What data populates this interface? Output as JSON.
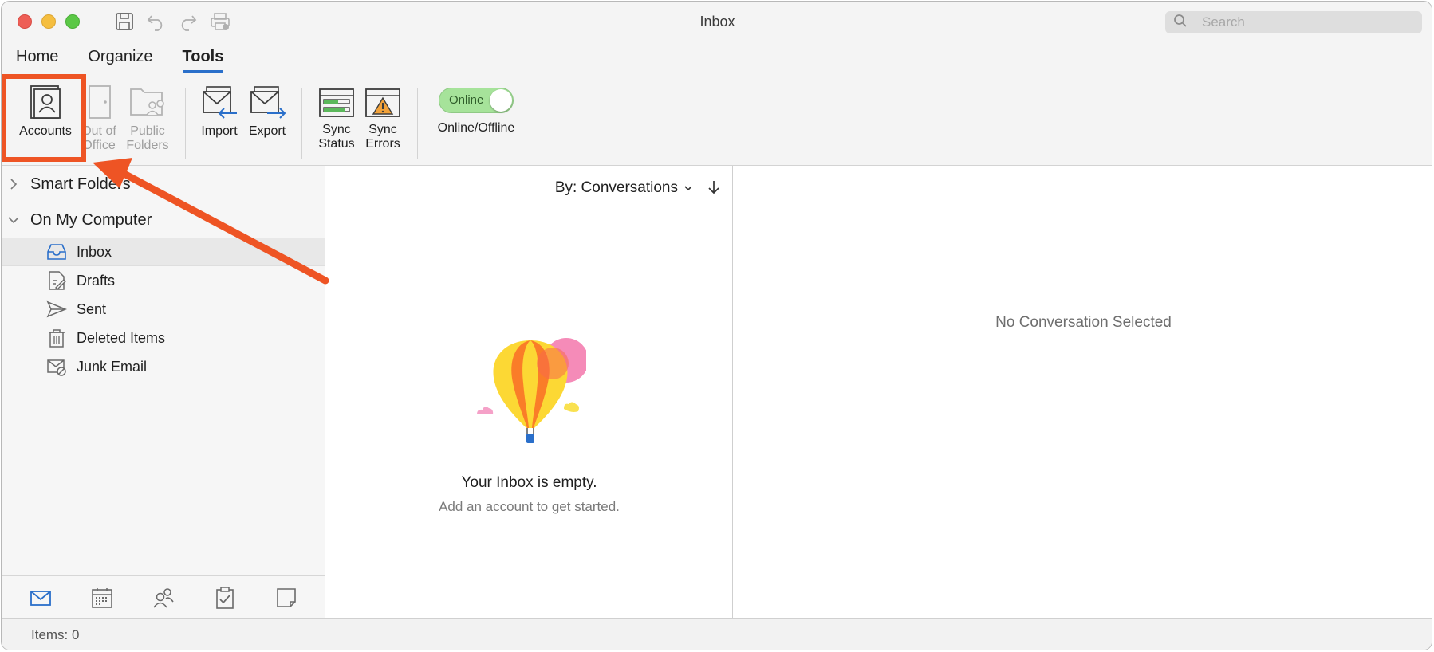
{
  "window": {
    "title": "Inbox"
  },
  "search": {
    "placeholder": "Search"
  },
  "tabs": [
    {
      "label": "Home",
      "active": false
    },
    {
      "label": "Organize",
      "active": false
    },
    {
      "label": "Tools",
      "active": true
    }
  ],
  "ribbon": {
    "accounts": {
      "line1": "Accounts",
      "line2": ""
    },
    "out_of_office": {
      "line1": "Out of",
      "line2": "Office"
    },
    "public_folders": {
      "line1": "Public",
      "line2": "Folders"
    },
    "import": {
      "line1": "Import"
    },
    "export": {
      "line1": "Export"
    },
    "sync_status": {
      "line1": "Sync",
      "line2": "Status"
    },
    "sync_errors": {
      "line1": "Sync",
      "line2": "Errors"
    },
    "online_toggle": {
      "state_label": "Online",
      "caption": "Online/Offline",
      "on": true
    }
  },
  "sidebar": {
    "groups": [
      {
        "label": "Smart Folders",
        "expanded": false
      },
      {
        "label": "On My Computer",
        "expanded": true
      }
    ],
    "folders": [
      {
        "label": "Inbox",
        "icon": "inbox-icon",
        "selected": true
      },
      {
        "label": "Drafts",
        "icon": "drafts-icon",
        "selected": false
      },
      {
        "label": "Sent",
        "icon": "sent-icon",
        "selected": false
      },
      {
        "label": "Deleted Items",
        "icon": "trash-icon",
        "selected": false
      },
      {
        "label": "Junk Email",
        "icon": "junk-icon",
        "selected": false
      }
    ],
    "nav_icons": [
      "mail-icon",
      "calendar-icon",
      "people-icon",
      "tasks-icon",
      "notes-icon"
    ]
  },
  "message_list": {
    "sort_label": "By: Conversations",
    "empty_title": "Your Inbox is empty.",
    "empty_subtitle": "Add an account to get started."
  },
  "reading_pane": {
    "empty_text": "No Conversation Selected"
  },
  "status_bar": {
    "items_text": "Items: 0"
  },
  "colors": {
    "accent": "#2a6fca",
    "annotation": "#ee5424",
    "toggle_on": "#a6e39a"
  }
}
